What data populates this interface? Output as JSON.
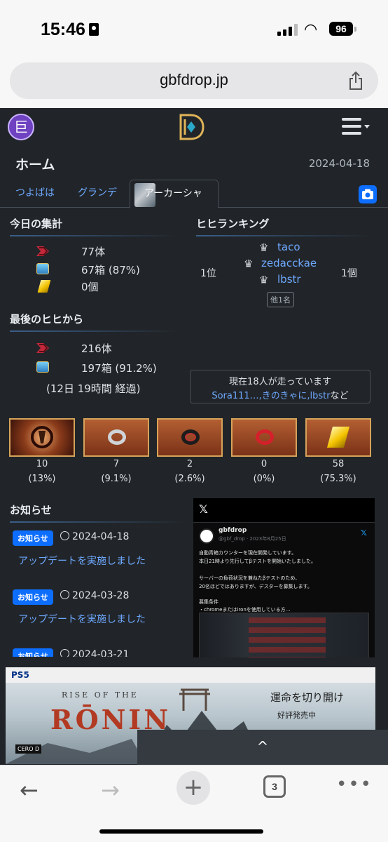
{
  "status": {
    "time": "15:46",
    "battery": "96"
  },
  "browser": {
    "url": "gbfdrop.jp",
    "tab_count": "3"
  },
  "header": {
    "avatar_char": "巨"
  },
  "page": {
    "title": "ホーム",
    "date": "2024-04-18"
  },
  "tabs": [
    {
      "label": "つよばは"
    },
    {
      "label": "グランデ"
    },
    {
      "label": "アーカーシャ",
      "active": true
    }
  ],
  "today": {
    "heading": "今日の集計",
    "kills": "77体",
    "chests": "67箱 (87%)",
    "gold": "0個"
  },
  "ranking": {
    "heading": "ヒヒランキング",
    "position": "1位",
    "names": [
      "taco",
      "zedacckae",
      "lbstr"
    ],
    "count": "1個",
    "others": "他1名"
  },
  "since_last": {
    "heading": "最後のヒヒから",
    "kills": "216体",
    "chests": "197箱 (91.2%)",
    "elapsed": "(12日 19時間 経過)"
  },
  "runners": {
    "line1": "現在18人が走っています",
    "names": "Sora111…,きのきゃに,lbstr",
    "suffix": "など"
  },
  "items": [
    {
      "count": "10",
      "pct": "(13%)",
      "kind": "emblem"
    },
    {
      "count": "7",
      "pct": "(9.1%)",
      "kind": "ring-silver"
    },
    {
      "count": "2",
      "pct": "(2.6%)",
      "kind": "ring-dark"
    },
    {
      "count": "0",
      "pct": "(0%)",
      "kind": "ring-red"
    },
    {
      "count": "58",
      "pct": "(75.3%)",
      "kind": "gold-bar"
    }
  ],
  "news": {
    "heading": "お知らせ",
    "badge": "お知らせ",
    "entries": [
      {
        "date": "2024-04-18",
        "title": "アップデートを実施しました"
      },
      {
        "date": "2024-03-28",
        "title": "アップデートを実施しました"
      },
      {
        "date": "2024-03-21",
        "title": ""
      }
    ]
  },
  "tweet": {
    "x_logo": "𝕏",
    "name": "gbfdrop",
    "handle": "@gbf_drop · 2023年8月25日",
    "lines": [
      "自動青箱カウンターを現在開発しています。",
      "本日21時より先行してβテストを開始いたしました。",
      "",
      "サーバーの負荷状況を兼ねたβテストのため、",
      "20名ほどではありますが、デスターを募集します。",
      "",
      "募集条件",
      "・chromeまたはironを使用している方…"
    ]
  },
  "ad": {
    "brand": "PS5",
    "rise": "RISE OF THE",
    "title": "RŌNIN",
    "tagline": "運命を切り開け",
    "sub": "好評発売中",
    "rating": "CERO D"
  },
  "scroll_top": "^"
}
